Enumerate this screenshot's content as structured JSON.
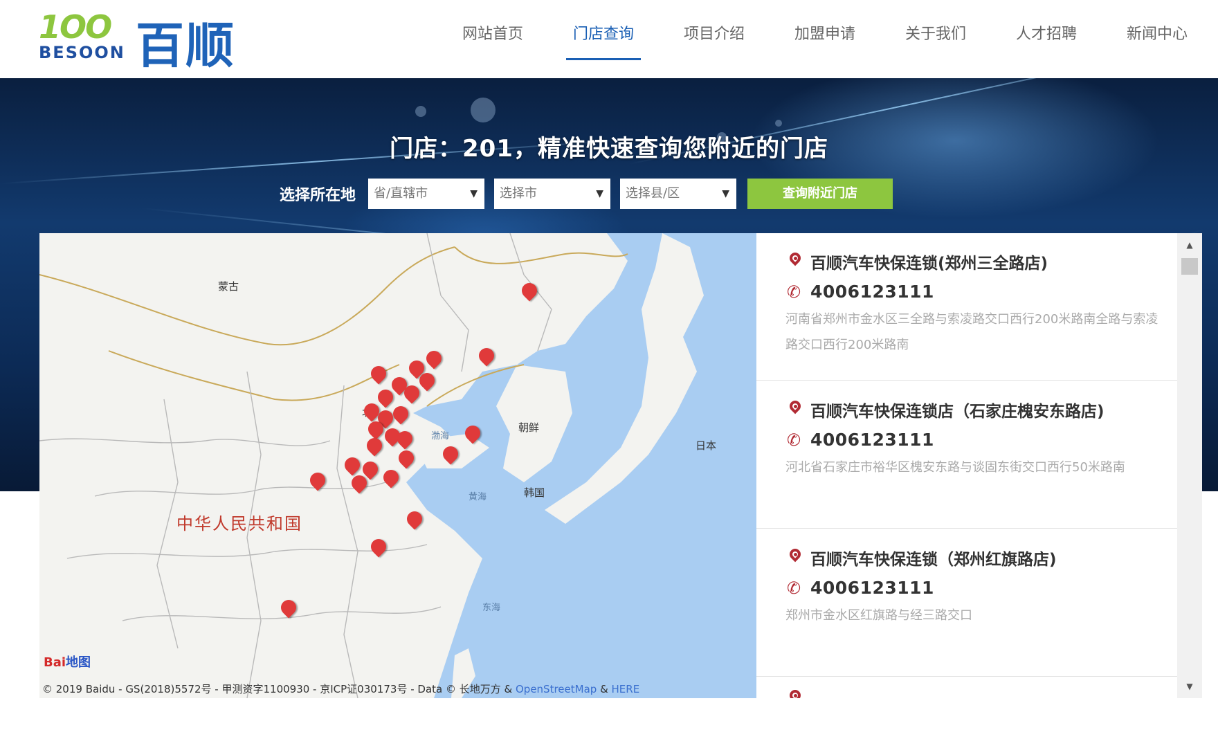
{
  "logo": {
    "number": "1OO",
    "english": "BESOON",
    "chinese": "百顺"
  },
  "nav": {
    "items": [
      {
        "label": "网站首页"
      },
      {
        "label": "门店查询"
      },
      {
        "label": "项目介绍"
      },
      {
        "label": "加盟申请"
      },
      {
        "label": "关于我们"
      },
      {
        "label": "人才招聘"
      },
      {
        "label": "新闻中心"
      }
    ],
    "active_index": 1
  },
  "banner": {
    "title": "门店：201，精准快速查询您附近的门店",
    "search_label": "选择所在地",
    "province_select": "省/直辖市",
    "city_select": "选择市",
    "district_select": "选择县/区",
    "search_button": "查询附近门店"
  },
  "map": {
    "labels": {
      "mongolia": "蒙古",
      "china": "中华人民共和国",
      "north_korea": "朝鲜",
      "south_korea": "韩国",
      "japan": "日本",
      "bohai": "渤海",
      "yellow_sea": "黄海",
      "east_sea": "东海",
      "beijing_partial": "北"
    },
    "baidu_logo": "Bai",
    "baidu_logo_suffix": "地图",
    "copyright_main": "© 2019 Baidu - GS(2018)5572号 - 甲测资字1100930 - 京ICP证030173号 - Data © 长地万方 & ",
    "copyright_osm": "OpenStreetMap",
    "copyright_amp": " & ",
    "copyright_here": "HERE"
  },
  "stores": [
    {
      "name": "百顺汽车快保连锁(郑州三全路店)",
      "phone": "4006123111",
      "address": "河南省郑州市金水区三全路与索凌路交口西行200米路南全路与索凌路交口西行200米路南"
    },
    {
      "name": "百顺汽车快保连锁店（石家庄槐安东路店)",
      "phone": "4006123111",
      "address": "河北省石家庄市裕华区槐安东路与谈固东街交口西行50米路南"
    },
    {
      "name": "百顺汽车快保连锁（郑州红旗路店)",
      "phone": "4006123111",
      "address": "郑州市金水区红旗路与经三路交口"
    }
  ],
  "icons": {
    "location": "location-pin-icon",
    "phone": "phone-icon",
    "dropdown": "dropdown-arrow-icon"
  },
  "colors": {
    "brand_blue": "#1a5fb4",
    "brand_green": "#8dc63f",
    "pin_red": "#e03a3a",
    "icon_red": "#b12a33"
  }
}
